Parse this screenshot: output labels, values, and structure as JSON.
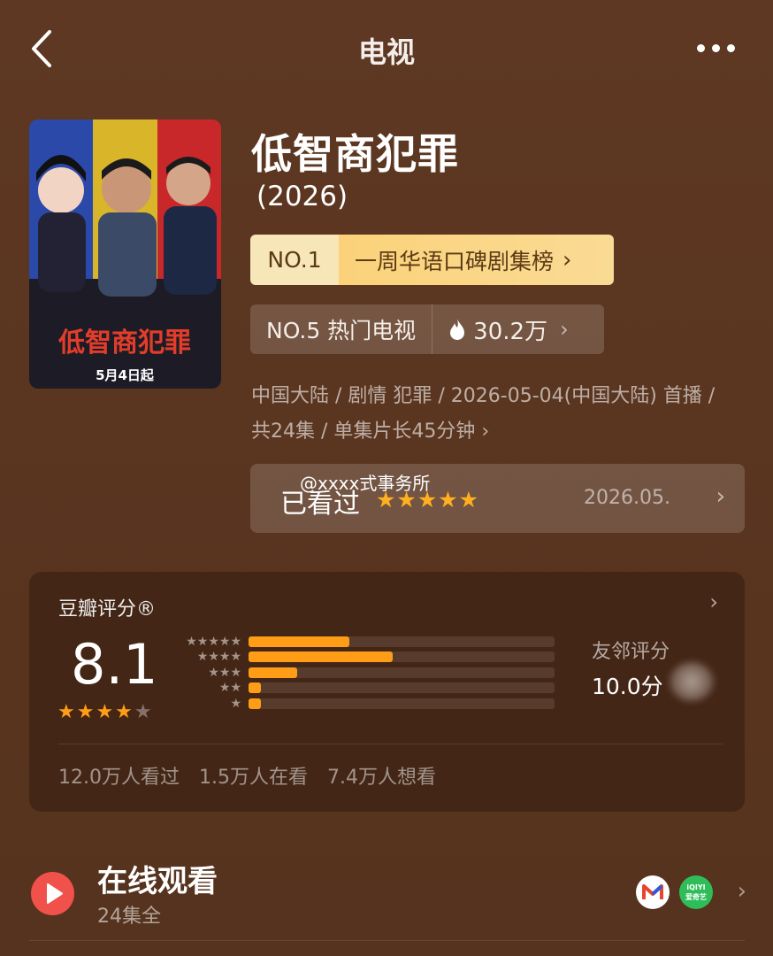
{
  "header": {
    "title": "电视",
    "back_icon": "back-arrow-icon",
    "more_icon": "more-dots-icon"
  },
  "poster": {
    "title_art": "低智商犯罪",
    "date_text": "5月4日起"
  },
  "show": {
    "title": "低智商犯罪",
    "year": "(2026)"
  },
  "rank": {
    "number": "NO.1",
    "label": "一周华语口碑剧集榜",
    "chevron": "›"
  },
  "hot": {
    "rank": "NO.5 热门电视",
    "count": "30.2万",
    "chevron": "›"
  },
  "meta": {
    "line": "中国大陆 / 剧情 犯罪 / 2026-05-04(中国大陆) 首播 / 共24集 / 单集片长45分钟",
    "chevron": "›"
  },
  "watched": {
    "label": "已看过",
    "watermark": "@xxxx式事务所",
    "stars": "★★★★★",
    "date": "2026.05.",
    "chevron": "›"
  },
  "rating": {
    "title": "豆瓣评分®",
    "score": "8.1",
    "stars_on": "★★★★",
    "stars_off": "★",
    "chevron": "›",
    "distribution": [
      {
        "stars": "★★★★★",
        "fraction": 0.33
      },
      {
        "stars": "★★★★",
        "fraction": 0.47
      },
      {
        "stars": "★★★",
        "fraction": 0.16
      },
      {
        "stars": "★★",
        "fraction": 0.04
      },
      {
        "stars": "★",
        "fraction": 0.04
      }
    ],
    "friend_label": "友邻评分",
    "friend_score": "10.0分",
    "stats": [
      "12.0万人看过",
      "1.5万人在看",
      "7.4万人想看"
    ]
  },
  "watch_online": {
    "title": "在线观看",
    "subtitle": "24集全",
    "chevron": "›",
    "iqiyi_text": "iQIYI",
    "iqiyi_sub": "爱奇艺"
  },
  "colors": {
    "accent": "#ff9e16",
    "play": "#f0524b",
    "rank_gold": "#fbd27a"
  }
}
